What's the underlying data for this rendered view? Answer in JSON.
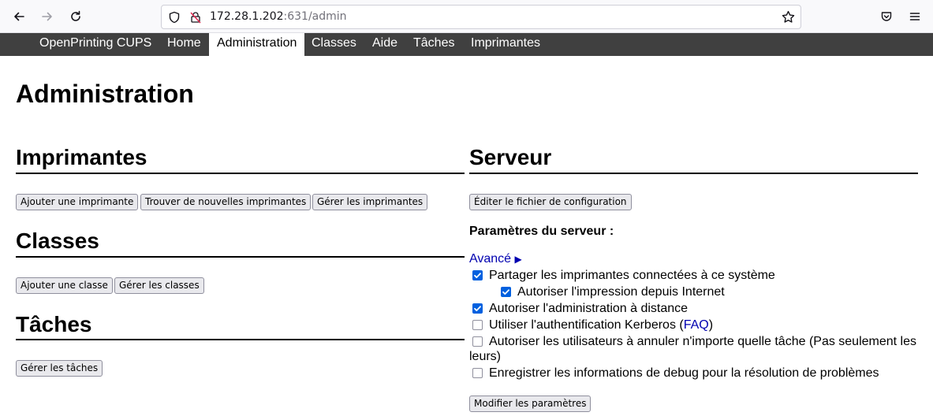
{
  "browser": {
    "url_host": "172.28.1.202",
    "url_path": ":631/admin"
  },
  "nav": {
    "items": [
      "OpenPrinting CUPS",
      "Home",
      "Administration",
      "Classes",
      "Aide",
      "Tâches",
      "Imprimantes"
    ],
    "active": "Administration"
  },
  "page": {
    "title": "Administration"
  },
  "printers": {
    "title": "Imprimantes",
    "buttons": [
      "Ajouter une imprimante",
      "Trouver de nouvelles imprimantes",
      "Gérer les imprimantes"
    ]
  },
  "classes": {
    "title": "Classes",
    "buttons": [
      "Ajouter une classe",
      "Gérer les classes"
    ]
  },
  "jobs": {
    "title": "Tâches",
    "buttons": [
      "Gérer les tâches"
    ]
  },
  "server": {
    "title": "Serveur",
    "edit_config_label": "Éditer le fichier de configuration",
    "settings_label": "Paramètres du serveur :",
    "advanced_label": "Avancé",
    "advanced_arrow": "▶",
    "options": [
      {
        "label": "Partager les imprimantes connectées à ce système",
        "checked": true
      },
      {
        "label": "Autoriser l'impression depuis Internet",
        "checked": true
      },
      {
        "label": "Autoriser l'administration à distance",
        "checked": true
      },
      {
        "label": "Utiliser l'authentification Kerberos (",
        "link": "FAQ",
        "suffix": ")",
        "checked": false
      },
      {
        "label": "Autoriser les utilisateurs à annuler n'importe quelle tâche (Pas seulement les",
        "label_line2": "leurs)",
        "checked": false
      },
      {
        "label": "Enregistrer les informations de debug pour la résolution de problèmes",
        "checked": false
      }
    ],
    "submit_label": "Modifier les paramètres"
  },
  "colors": {
    "nav_bg": "#404040",
    "checkbox_on": "#0060df",
    "link": "#0000b0"
  },
  "icons": [
    "back-icon",
    "forward-icon",
    "reload-icon",
    "shield-icon",
    "insecure-lock-icon",
    "star-icon",
    "pocket-icon",
    "menu-icon",
    "triangle-right-icon"
  ]
}
